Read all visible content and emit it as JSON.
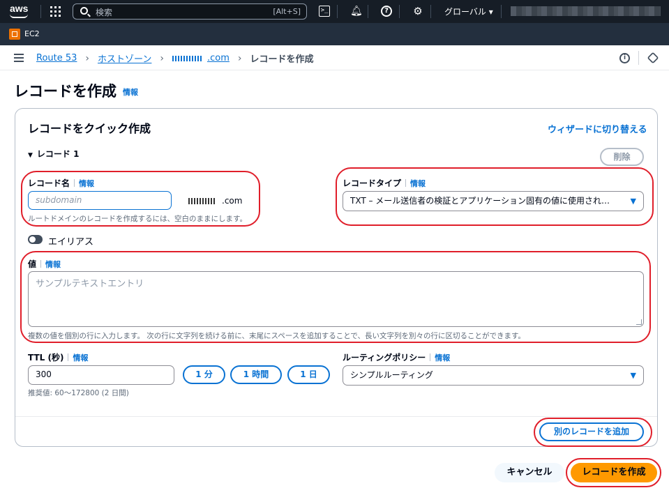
{
  "colors": {
    "accent": "#0972d3",
    "primary_button": "#ff9900",
    "topnav": "#161d26",
    "annotation": "#e01e2a"
  },
  "topnav": {
    "logo": "aws",
    "search_placeholder": "検索",
    "search_shortcut": "[Alt+S]",
    "region": "グローバル ▾",
    "icons": [
      "grid-icon",
      "cloudshell-icon",
      "bell-icon",
      "help-icon",
      "gear-icon"
    ]
  },
  "servicebar": {
    "service": "EC2"
  },
  "breadcrumb": {
    "items": [
      "Route 53",
      "ホストゾーン",
      ".com"
    ],
    "current": "レコードを作成"
  },
  "page": {
    "title": "レコードを作成",
    "info": "情報"
  },
  "quick_create": {
    "title": "レコードをクイック作成",
    "wizard_link": "ウィザードに切り替える",
    "record_section": "レコード 1",
    "delete_label": "削除",
    "record_name": {
      "label": "レコード名",
      "info": "情報",
      "placeholder": "subdomain",
      "suffix": ".com",
      "hint": "ルートドメインのレコードを作成するには、空白のままにします。"
    },
    "record_type": {
      "label": "レコードタイプ",
      "info": "情報",
      "value": "TXT – メール送信者の検証とアプリケーション固有の値に使用され…"
    },
    "alias": {
      "label": "エイリアス",
      "enabled": false
    },
    "value": {
      "label": "値",
      "info": "情報",
      "placeholder": "サンプルテキストエントリ",
      "hint": "複数の値を個別の行に入力します。 次の行に文字列を続ける前に、末尾にスペースを追加することで、長い文字列を別々の行に区切ることができます。"
    },
    "ttl": {
      "label": "TTL (秒)",
      "info": "情報",
      "value": "300",
      "presets": [
        "1 分",
        "1 時間",
        "1 日"
      ],
      "hint": "推奨値: 60～172800 (2 日間)"
    },
    "routing_policy": {
      "label": "ルーティングポリシー",
      "info": "情報",
      "value": "シンプルルーティング"
    },
    "add_record_label": "別のレコードを追加"
  },
  "footer": {
    "cancel_label": "キャンセル",
    "create_label": "レコードを作成"
  }
}
